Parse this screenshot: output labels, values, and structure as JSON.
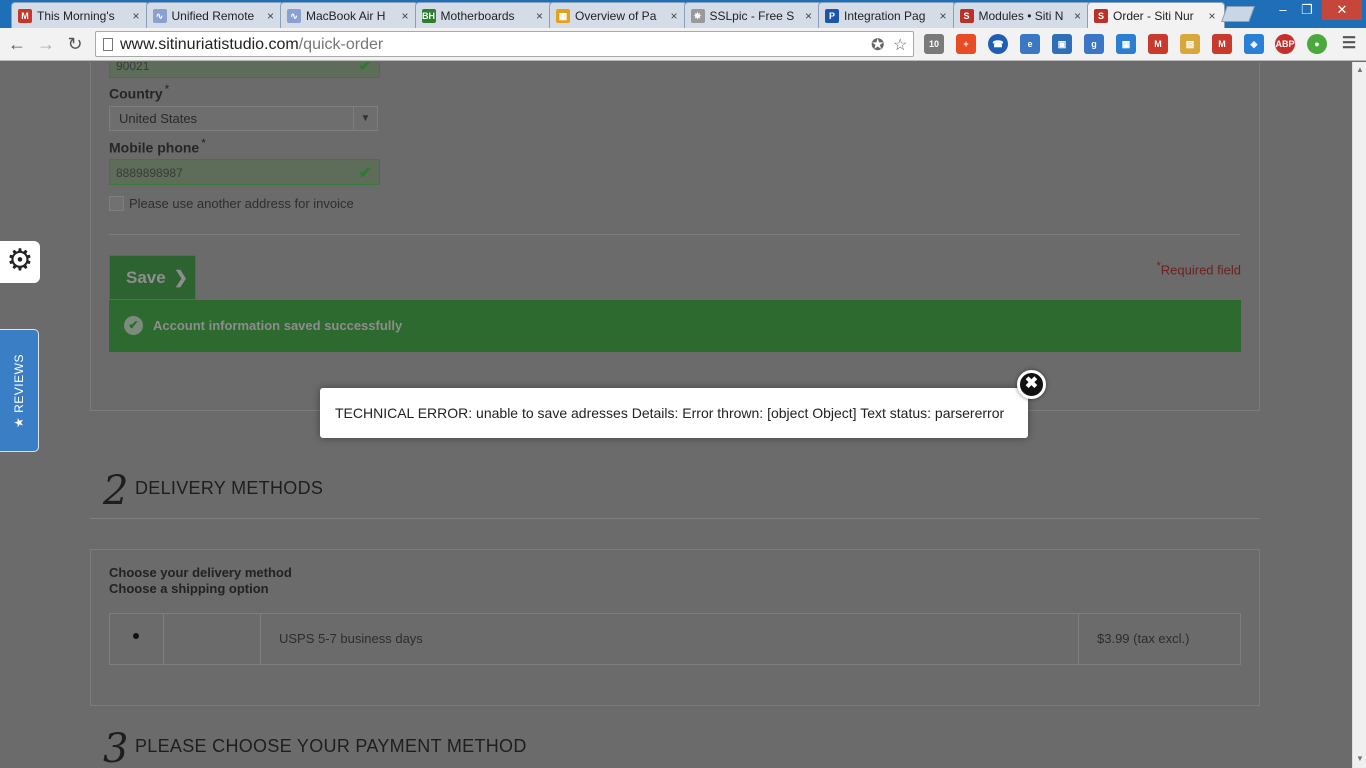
{
  "browser": {
    "tabs": [
      {
        "title": "This Morning's",
        "icon": "gmail-icon",
        "color": "#c53727",
        "glyph": "M"
      },
      {
        "title": "Unified Remote",
        "icon": "loading-icon",
        "color": "#8aa0d0",
        "glyph": "∿"
      },
      {
        "title": "MacBook Air H",
        "icon": "loading-icon",
        "color": "#8aa0d0",
        "glyph": "∿"
      },
      {
        "title": "Motherboards",
        "icon": "bh-icon",
        "color": "#2f7d32",
        "glyph": "BH"
      },
      {
        "title": "Overview of Pa",
        "icon": "page-icon",
        "color": "#e3a21a",
        "glyph": "▦"
      },
      {
        "title": "SSLpic - Free S",
        "icon": "loading-icon",
        "color": "#999999",
        "glyph": "✵"
      },
      {
        "title": "Integration Pag",
        "icon": "paypal-icon",
        "color": "#1d56a8",
        "glyph": "P"
      },
      {
        "title": "Modules • Siti N",
        "icon": "prestashop-icon",
        "color": "#b8322a",
        "glyph": "S"
      },
      {
        "title": "Order - Siti Nur",
        "icon": "prestashop-icon",
        "color": "#b8322a",
        "glyph": "S"
      }
    ],
    "url_host": "www.sitinuriatistudio.com",
    "url_path": "/quick-order"
  },
  "form": {
    "zip_value": "90021",
    "country_label": "Country",
    "country_value": "United States",
    "phone_label": "Mobile phone",
    "phone_value": "8889898987",
    "required_mark": "*",
    "invoice_checkbox_label": "Please use another address for invoice",
    "save_label": "Save",
    "required_note": "Required field",
    "success_message": "Account information saved successfully"
  },
  "delivery": {
    "step_number": "2",
    "title": "DELIVERY METHODS",
    "choose_method": "Choose your delivery method",
    "choose_option": "Choose a shipping option",
    "carrier": "USPS 5-7 business days",
    "price": "$3.99 (tax excl.)"
  },
  "payment": {
    "step_number": "3",
    "title": "PLEASE CHOOSE YOUR PAYMENT METHOD"
  },
  "side": {
    "reviews_label": "★ REVIEWS"
  },
  "modal": {
    "error_text": "TECHNICAL ERROR: unable to save adresses Details: Error thrown: [object Object] Text status: parsererror"
  }
}
